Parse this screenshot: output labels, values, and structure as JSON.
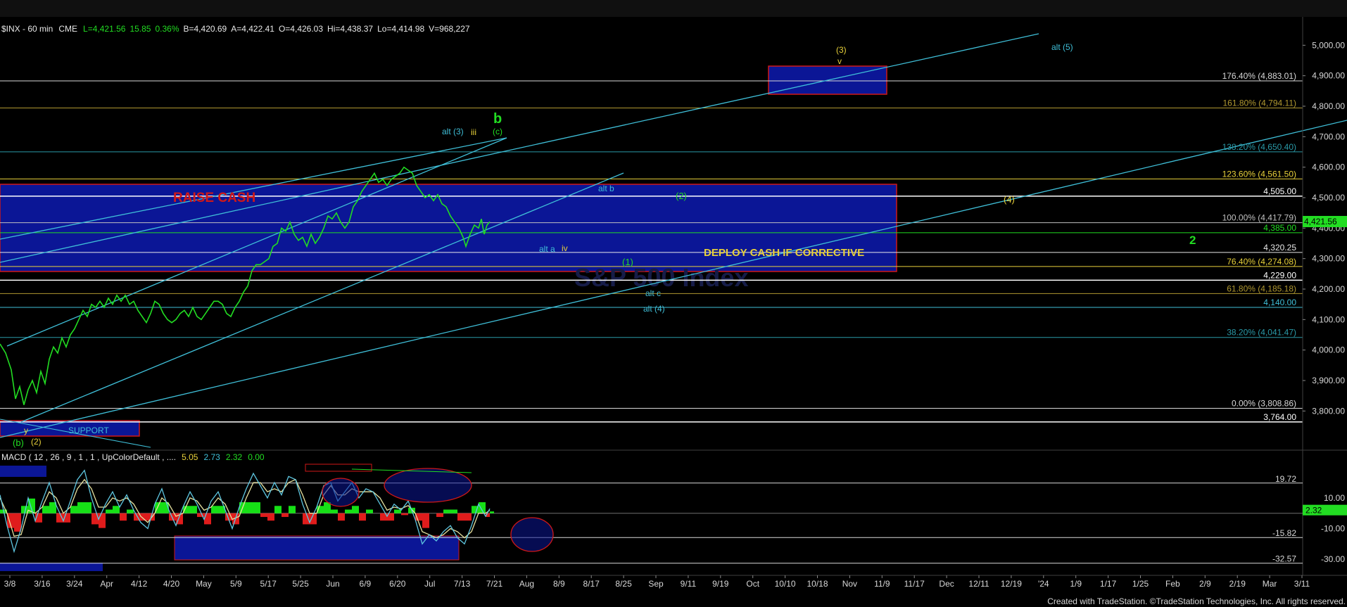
{
  "header": {
    "symbol": "$INX - 60 min",
    "exchange": "CME",
    "last": "L=4,421.56",
    "change": "15.85",
    "change_pct": "0.36%",
    "bid": "B=4,420.69",
    "ask": "A=4,422.41",
    "open": "O=4,426.03",
    "high": "Hi=4,438.37",
    "low": "Lo=4,414.98",
    "volume": "V=968,227"
  },
  "colors": {
    "background": "#000000",
    "price": "#22dd22",
    "cyan": "#3fbfd8",
    "yellow": "#e8d13a",
    "white": "#e8e8e8",
    "navy": "#0b1696",
    "red_border": "#d01818",
    "macd_line": "#5ec6e0",
    "signal_line": "#e8e3a0",
    "hist_up": "#16e016",
    "hist_down": "#e01c1c"
  },
  "chart_data": [
    {
      "type": "line",
      "name": "price",
      "ylim": [
        3720,
        5010
      ],
      "y_ticks": [
        5000,
        4900,
        4800,
        4700,
        4600,
        4500,
        4400,
        4300,
        4200,
        4100,
        4000,
        3900,
        3800
      ],
      "y_tick_labels": [
        "5,000.00",
        "4,900.00",
        "4,800.00",
        "4,700.00",
        "4,600.00",
        "4,500.00",
        "4,400.00",
        "4,300.00",
        "4,200.00",
        "4,100.00",
        "4,000.00",
        "3,900.00",
        "3,800.00"
      ],
      "x_axis_labels": [
        "3/8",
        "3/16",
        "3/24",
        "Apr",
        "4/12",
        "4/20",
        "May",
        "5/9",
        "5/17",
        "5/25",
        "Jun",
        "6/9",
        "6/20",
        "Jul",
        "7/13",
        "7/21",
        "Aug",
        "8/9",
        "8/17",
        "8/25",
        "Sep",
        "9/11",
        "9/19",
        "Oct",
        "10/10",
        "10/18",
        "Nov",
        "11/9",
        "11/17",
        "Dec",
        "12/11",
        "12/19",
        "'24",
        "1/9",
        "1/17",
        "1/25",
        "Feb",
        "2/9",
        "2/19",
        "Mar",
        "3/11"
      ],
      "last_price_label": "4,421.56",
      "series_points": [
        [
          0,
          4020
        ],
        [
          8,
          3990
        ],
        [
          16,
          3935
        ],
        [
          22,
          3840
        ],
        [
          28,
          3880
        ],
        [
          34,
          3820
        ],
        [
          40,
          3870
        ],
        [
          46,
          3900
        ],
        [
          52,
          3860
        ],
        [
          58,
          3930
        ],
        [
          64,
          3890
        ],
        [
          70,
          3970
        ],
        [
          76,
          4010
        ],
        [
          82,
          3990
        ],
        [
          88,
          4040
        ],
        [
          94,
          4010
        ],
        [
          100,
          4050
        ],
        [
          106,
          4070
        ],
        [
          112,
          4100
        ],
        [
          118,
          4130
        ],
        [
          124,
          4110
        ],
        [
          130,
          4150
        ],
        [
          136,
          4140
        ],
        [
          142,
          4160
        ],
        [
          148,
          4140
        ],
        [
          154,
          4170
        ],
        [
          160,
          4150
        ],
        [
          166,
          4180
        ],
        [
          172,
          4160
        ],
        [
          178,
          4180
        ],
        [
          184,
          4150
        ],
        [
          190,
          4160
        ],
        [
          196,
          4130
        ],
        [
          202,
          4110
        ],
        [
          208,
          4090
        ],
        [
          214,
          4120
        ],
        [
          220,
          4160
        ],
        [
          226,
          4150
        ],
        [
          232,
          4120
        ],
        [
          238,
          4100
        ],
        [
          244,
          4090
        ],
        [
          250,
          4100
        ],
        [
          256,
          4120
        ],
        [
          262,
          4130
        ],
        [
          268,
          4110
        ],
        [
          274,
          4140
        ],
        [
          280,
          4110
        ],
        [
          286,
          4100
        ],
        [
          292,
          4120
        ],
        [
          298,
          4140
        ],
        [
          304,
          4160
        ],
        [
          310,
          4160
        ],
        [
          316,
          4150
        ],
        [
          322,
          4120
        ],
        [
          328,
          4110
        ],
        [
          334,
          4140
        ],
        [
          340,
          4160
        ],
        [
          346,
          4190
        ],
        [
          352,
          4210
        ],
        [
          358,
          4260
        ],
        [
          364,
          4280
        ],
        [
          370,
          4280
        ],
        [
          376,
          4290
        ],
        [
          382,
          4300
        ],
        [
          388,
          4340
        ],
        [
          394,
          4350
        ],
        [
          400,
          4400
        ],
        [
          406,
          4390
        ],
        [
          412,
          4420
        ],
        [
          418,
          4380
        ],
        [
          424,
          4360
        ],
        [
          430,
          4370
        ],
        [
          436,
          4340
        ],
        [
          442,
          4380
        ],
        [
          448,
          4350
        ],
        [
          454,
          4370
        ],
        [
          460,
          4400
        ],
        [
          466,
          4440
        ],
        [
          472,
          4430
        ],
        [
          478,
          4450
        ],
        [
          484,
          4420
        ],
        [
          490,
          4400
        ],
        [
          496,
          4420
        ],
        [
          502,
          4470
        ],
        [
          508,
          4490
        ],
        [
          514,
          4520
        ],
        [
          520,
          4540
        ],
        [
          526,
          4560
        ],
        [
          532,
          4580
        ],
        [
          538,
          4550
        ],
        [
          544,
          4560
        ],
        [
          550,
          4540
        ],
        [
          556,
          4560
        ],
        [
          562,
          4570
        ],
        [
          568,
          4580
        ],
        [
          574,
          4600
        ],
        [
          580,
          4590
        ],
        [
          586,
          4580
        ],
        [
          592,
          4540
        ],
        [
          598,
          4520
        ],
        [
          604,
          4500
        ],
        [
          610,
          4510
        ],
        [
          616,
          4490
        ],
        [
          622,
          4510
        ],
        [
          628,
          4480
        ],
        [
          634,
          4470
        ],
        [
          640,
          4440
        ],
        [
          646,
          4420
        ],
        [
          652,
          4400
        ],
        [
          658,
          4370
        ],
        [
          662,
          4340
        ],
        [
          668,
          4380
        ],
        [
          674,
          4410
        ],
        [
          680,
          4400
        ],
        [
          684,
          4430
        ],
        [
          688,
          4380
        ],
        [
          692,
          4410
        ],
        [
          696,
          4421
        ]
      ],
      "macd_ylim": [
        -35,
        32
      ],
      "macd_ticks": [
        10,
        -10,
        -30
      ],
      "macd_tick_labels": [
        "10.00",
        "-10.00",
        "-30.00"
      ],
      "macd_levels": [
        19.72,
        -15.82,
        -32.57
      ],
      "macd_level_labels": [
        "19.72",
        "-15.82",
        "-32.57"
      ],
      "macd_last_label": "2.32",
      "macd_points": [
        [
          0,
          12
        ],
        [
          10,
          -8
        ],
        [
          20,
          -25
        ],
        [
          30,
          -10
        ],
        [
          40,
          10
        ],
        [
          50,
          -5
        ],
        [
          60,
          8
        ],
        [
          70,
          20
        ],
        [
          80,
          5
        ],
        [
          90,
          -5
        ],
        [
          100,
          8
        ],
        [
          110,
          22
        ],
        [
          120,
          28
        ],
        [
          130,
          10
        ],
        [
          140,
          -4
        ],
        [
          150,
          6
        ],
        [
          160,
          14
        ],
        [
          170,
          4
        ],
        [
          180,
          12
        ],
        [
          190,
          2
        ],
        [
          200,
          -6
        ],
        [
          210,
          -10
        ],
        [
          220,
          6
        ],
        [
          230,
          16
        ],
        [
          240,
          2
        ],
        [
          250,
          -8
        ],
        [
          260,
          4
        ],
        [
          270,
          14
        ],
        [
          280,
          6
        ],
        [
          290,
          -4
        ],
        [
          300,
          8
        ],
        [
          310,
          14
        ],
        [
          320,
          2
        ],
        [
          330,
          -10
        ],
        [
          340,
          4
        ],
        [
          350,
          16
        ],
        [
          360,
          26
        ],
        [
          370,
          18
        ],
        [
          380,
          10
        ],
        [
          390,
          20
        ],
        [
          400,
          12
        ],
        [
          410,
          24
        ],
        [
          420,
          22
        ],
        [
          430,
          6
        ],
        [
          440,
          -6
        ],
        [
          450,
          4
        ],
        [
          460,
          18
        ],
        [
          470,
          20
        ],
        [
          480,
          8
        ],
        [
          490,
          14
        ],
        [
          500,
          20
        ],
        [
          510,
          10
        ],
        [
          520,
          16
        ],
        [
          530,
          14
        ],
        [
          540,
          6
        ],
        [
          550,
          -2
        ],
        [
          560,
          6
        ],
        [
          570,
          2
        ],
        [
          580,
          8
        ],
        [
          590,
          -4
        ],
        [
          600,
          -20
        ],
        [
          610,
          -14
        ],
        [
          620,
          -18
        ],
        [
          630,
          -12
        ],
        [
          640,
          -8
        ],
        [
          650,
          -16
        ],
        [
          660,
          -20
        ],
        [
          670,
          -8
        ],
        [
          680,
          6
        ],
        [
          690,
          -2
        ],
        [
          696,
          3
        ]
      ],
      "signal_points": [
        [
          0,
          10
        ],
        [
          10,
          0
        ],
        [
          20,
          -15
        ],
        [
          30,
          -14
        ],
        [
          40,
          2
        ],
        [
          50,
          0
        ],
        [
          60,
          4
        ],
        [
          70,
          14
        ],
        [
          80,
          10
        ],
        [
          90,
          0
        ],
        [
          100,
          4
        ],
        [
          110,
          16
        ],
        [
          120,
          22
        ],
        [
          130,
          16
        ],
        [
          140,
          4
        ],
        [
          150,
          4
        ],
        [
          160,
          10
        ],
        [
          170,
          8
        ],
        [
          180,
          10
        ],
        [
          190,
          6
        ],
        [
          200,
          -2
        ],
        [
          210,
          -6
        ],
        [
          220,
          0
        ],
        [
          230,
          10
        ],
        [
          240,
          6
        ],
        [
          250,
          -2
        ],
        [
          260,
          0
        ],
        [
          270,
          10
        ],
        [
          280,
          8
        ],
        [
          290,
          2
        ],
        [
          300,
          4
        ],
        [
          310,
          10
        ],
        [
          320,
          6
        ],
        [
          330,
          -4
        ],
        [
          340,
          -2
        ],
        [
          350,
          10
        ],
        [
          360,
          20
        ],
        [
          370,
          20
        ],
        [
          380,
          14
        ],
        [
          390,
          16
        ],
        [
          400,
          14
        ],
        [
          410,
          20
        ],
        [
          420,
          22
        ],
        [
          430,
          12
        ],
        [
          440,
          0
        ],
        [
          450,
          0
        ],
        [
          460,
          12
        ],
        [
          470,
          18
        ],
        [
          480,
          12
        ],
        [
          490,
          12
        ],
        [
          500,
          16
        ],
        [
          510,
          14
        ],
        [
          520,
          14
        ],
        [
          530,
          14
        ],
        [
          540,
          10
        ],
        [
          550,
          2
        ],
        [
          560,
          4
        ],
        [
          570,
          3
        ],
        [
          580,
          5
        ],
        [
          590,
          0
        ],
        [
          600,
          -12
        ],
        [
          610,
          -14
        ],
        [
          620,
          -16
        ],
        [
          630,
          -14
        ],
        [
          640,
          -10
        ],
        [
          650,
          -12
        ],
        [
          660,
          -16
        ],
        [
          670,
          -12
        ],
        [
          680,
          0
        ],
        [
          690,
          0
        ],
        [
          696,
          2
        ]
      ],
      "macd_values_label": "5.05",
      "signal_values_label": "2.73",
      "hist_values_label": "2.32",
      "zero_values_label": "0.00",
      "macd_title": "MACD ( 12 , 26 , 9 , 1 , 1 , UpColorDefault , ...."
    }
  ],
  "fib_levels": [
    {
      "price": 4883.01,
      "label": "176.40% (4,883.01)",
      "color": "#d8d8d8"
    },
    {
      "price": 4794.11,
      "label": "161.80% (4,794.11)",
      "color": "#b09830"
    },
    {
      "price": 4650.4,
      "label": "138.20% (4,650.40)",
      "color": "#2a9aa8"
    },
    {
      "price": 4561.5,
      "label": "123.60% (4,561.50)",
      "color": "#e8d13a"
    },
    {
      "price": 4505.0,
      "label": "4,505.00",
      "color": "#ffffff"
    },
    {
      "price": 4417.79,
      "label": "100.00% (4,417.79)",
      "color": "#c0c0c0"
    },
    {
      "price": 4385.0,
      "label": "4,385.00",
      "color": "#22dd22"
    },
    {
      "price": 4320.25,
      "label": "4,320.25",
      "color": "#e8e8e8"
    },
    {
      "price": 4274.08,
      "label": "76.40% (4,274.08)",
      "color": "#e8d13a"
    },
    {
      "price": 4229.0,
      "label": "4,229.00",
      "color": "#ffffff"
    },
    {
      "price": 4185.18,
      "label": "61.80% (4,185.18)",
      "color": "#b09830"
    },
    {
      "price": 4140.0,
      "label": "4,140.00",
      "color": "#3fbfd8"
    },
    {
      "price": 4041.47,
      "label": "38.20% (4,041.47)",
      "color": "#2a9aa8"
    },
    {
      "price": 3808.86,
      "label": "0.00% (3,808.86)",
      "color": "#d8d8d8"
    },
    {
      "price": 3764.0,
      "label": "3,764.00",
      "color": "#ffffff"
    }
  ],
  "zones": [
    {
      "label": "RAISE CASH"
    },
    {
      "label": "DEPLOY CASH IF CORRECTIVE"
    },
    {
      "label": "SUPPORT"
    }
  ],
  "wave_labels": [
    {
      "text": "b",
      "color": "#22dd22"
    },
    {
      "text": "alt (3)",
      "color": "#3fbfd8"
    },
    {
      "text": "iii",
      "color": "#e8d13a"
    },
    {
      "text": "(c)",
      "color": "#22dd22"
    },
    {
      "text": "(3)",
      "color": "#e8d13a"
    },
    {
      "text": "v",
      "color": "#e8d13a"
    },
    {
      "text": "alt (5)",
      "color": "#3fbfd8"
    },
    {
      "text": "alt b",
      "color": "#3fbfd8"
    },
    {
      "text": "(2)",
      "color": "#22dd22"
    },
    {
      "text": "(4)",
      "color": "#e8d13a"
    },
    {
      "text": "alt a",
      "color": "#3fbfd8"
    },
    {
      "text": "iv",
      "color": "#e8d13a"
    },
    {
      "text": "(1)",
      "color": "#22dd22"
    },
    {
      "text": "alt c",
      "color": "#3fbfd8"
    },
    {
      "text": "alt (4)",
      "color": "#3fbfd8"
    },
    {
      "text": "2",
      "color": "#22dd22"
    },
    {
      "text": "y",
      "color": "#e8d13a"
    },
    {
      "text": "(b)",
      "color": "#22dd22"
    },
    {
      "text": "(2)",
      "color": "#e8d13a"
    }
  ],
  "watermark": "S&P 500 Index",
  "footer": "Created with TradeStation. ©TradeStation Technologies, Inc. All rights reserved."
}
